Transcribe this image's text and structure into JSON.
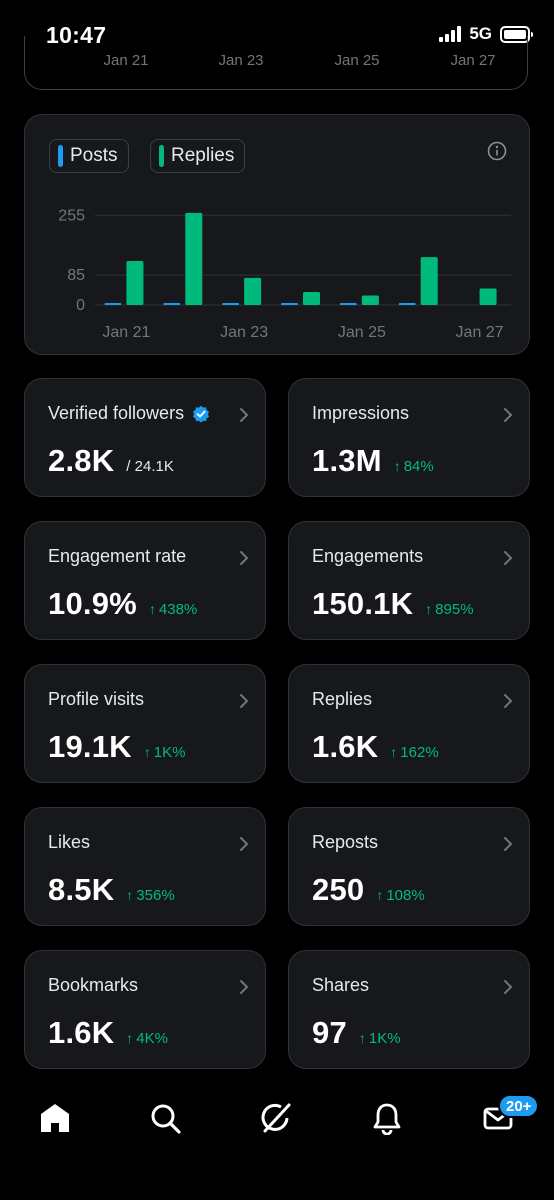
{
  "status_bar": {
    "time": "10:47",
    "network": "5G",
    "signal_bars": 4
  },
  "previous_chart": {
    "tick_labels": [
      "Jan 21",
      "Jan 23",
      "Jan 25",
      "Jan 27"
    ]
  },
  "chart_legend": {
    "posts_label": "Posts",
    "replies_label": "Replies",
    "posts_color": "#1d9bf0",
    "replies_color": "#00ba7c"
  },
  "chart_data": {
    "type": "bar",
    "categories": [
      "Jan 21",
      "Jan 22",
      "Jan 23",
      "Jan 24",
      "Jan 25",
      "Jan 26",
      "Jan 27"
    ],
    "x_tick_labels": [
      "Jan 21",
      "Jan 23",
      "Jan 25",
      "Jan 27"
    ],
    "series": [
      {
        "name": "Posts",
        "color": "#1d9bf0",
        "values": [
          1,
          1,
          1,
          3,
          1,
          1,
          0
        ]
      },
      {
        "name": "Replies",
        "color": "#00ba7c",
        "values": [
          125,
          262,
          77,
          37,
          27,
          136,
          47
        ]
      }
    ],
    "y_ticks": [
      0,
      85,
      255
    ],
    "ylim": [
      0,
      270
    ],
    "grid": true
  },
  "metrics": [
    {
      "title": "Verified followers",
      "value": "2.8K",
      "sub": "/ 24.1K",
      "delta": "",
      "verified_icon": true
    },
    {
      "title": "Impressions",
      "value": "1.3M",
      "sub": "",
      "delta": "84%"
    },
    {
      "title": "Engagement rate",
      "value": "10.9%",
      "sub": "",
      "delta": "438%"
    },
    {
      "title": "Engagements",
      "value": "150.1K",
      "sub": "",
      "delta": "895%"
    },
    {
      "title": "Profile visits",
      "value": "19.1K",
      "sub": "",
      "delta": "1K%"
    },
    {
      "title": "Replies",
      "value": "1.6K",
      "sub": "",
      "delta": "162%"
    },
    {
      "title": "Likes",
      "value": "8.5K",
      "sub": "",
      "delta": "356%"
    },
    {
      "title": "Reposts",
      "value": "250",
      "sub": "",
      "delta": "108%"
    },
    {
      "title": "Bookmarks",
      "value": "1.6K",
      "sub": "",
      "delta": "4K%"
    },
    {
      "title": "Shares",
      "value": "97",
      "sub": "",
      "delta": "1K%"
    }
  ],
  "bottom_nav": {
    "items": [
      "home-icon",
      "search-icon",
      "grok-icon",
      "notifications-icon",
      "messages-icon"
    ],
    "messages_badge": "20+"
  }
}
